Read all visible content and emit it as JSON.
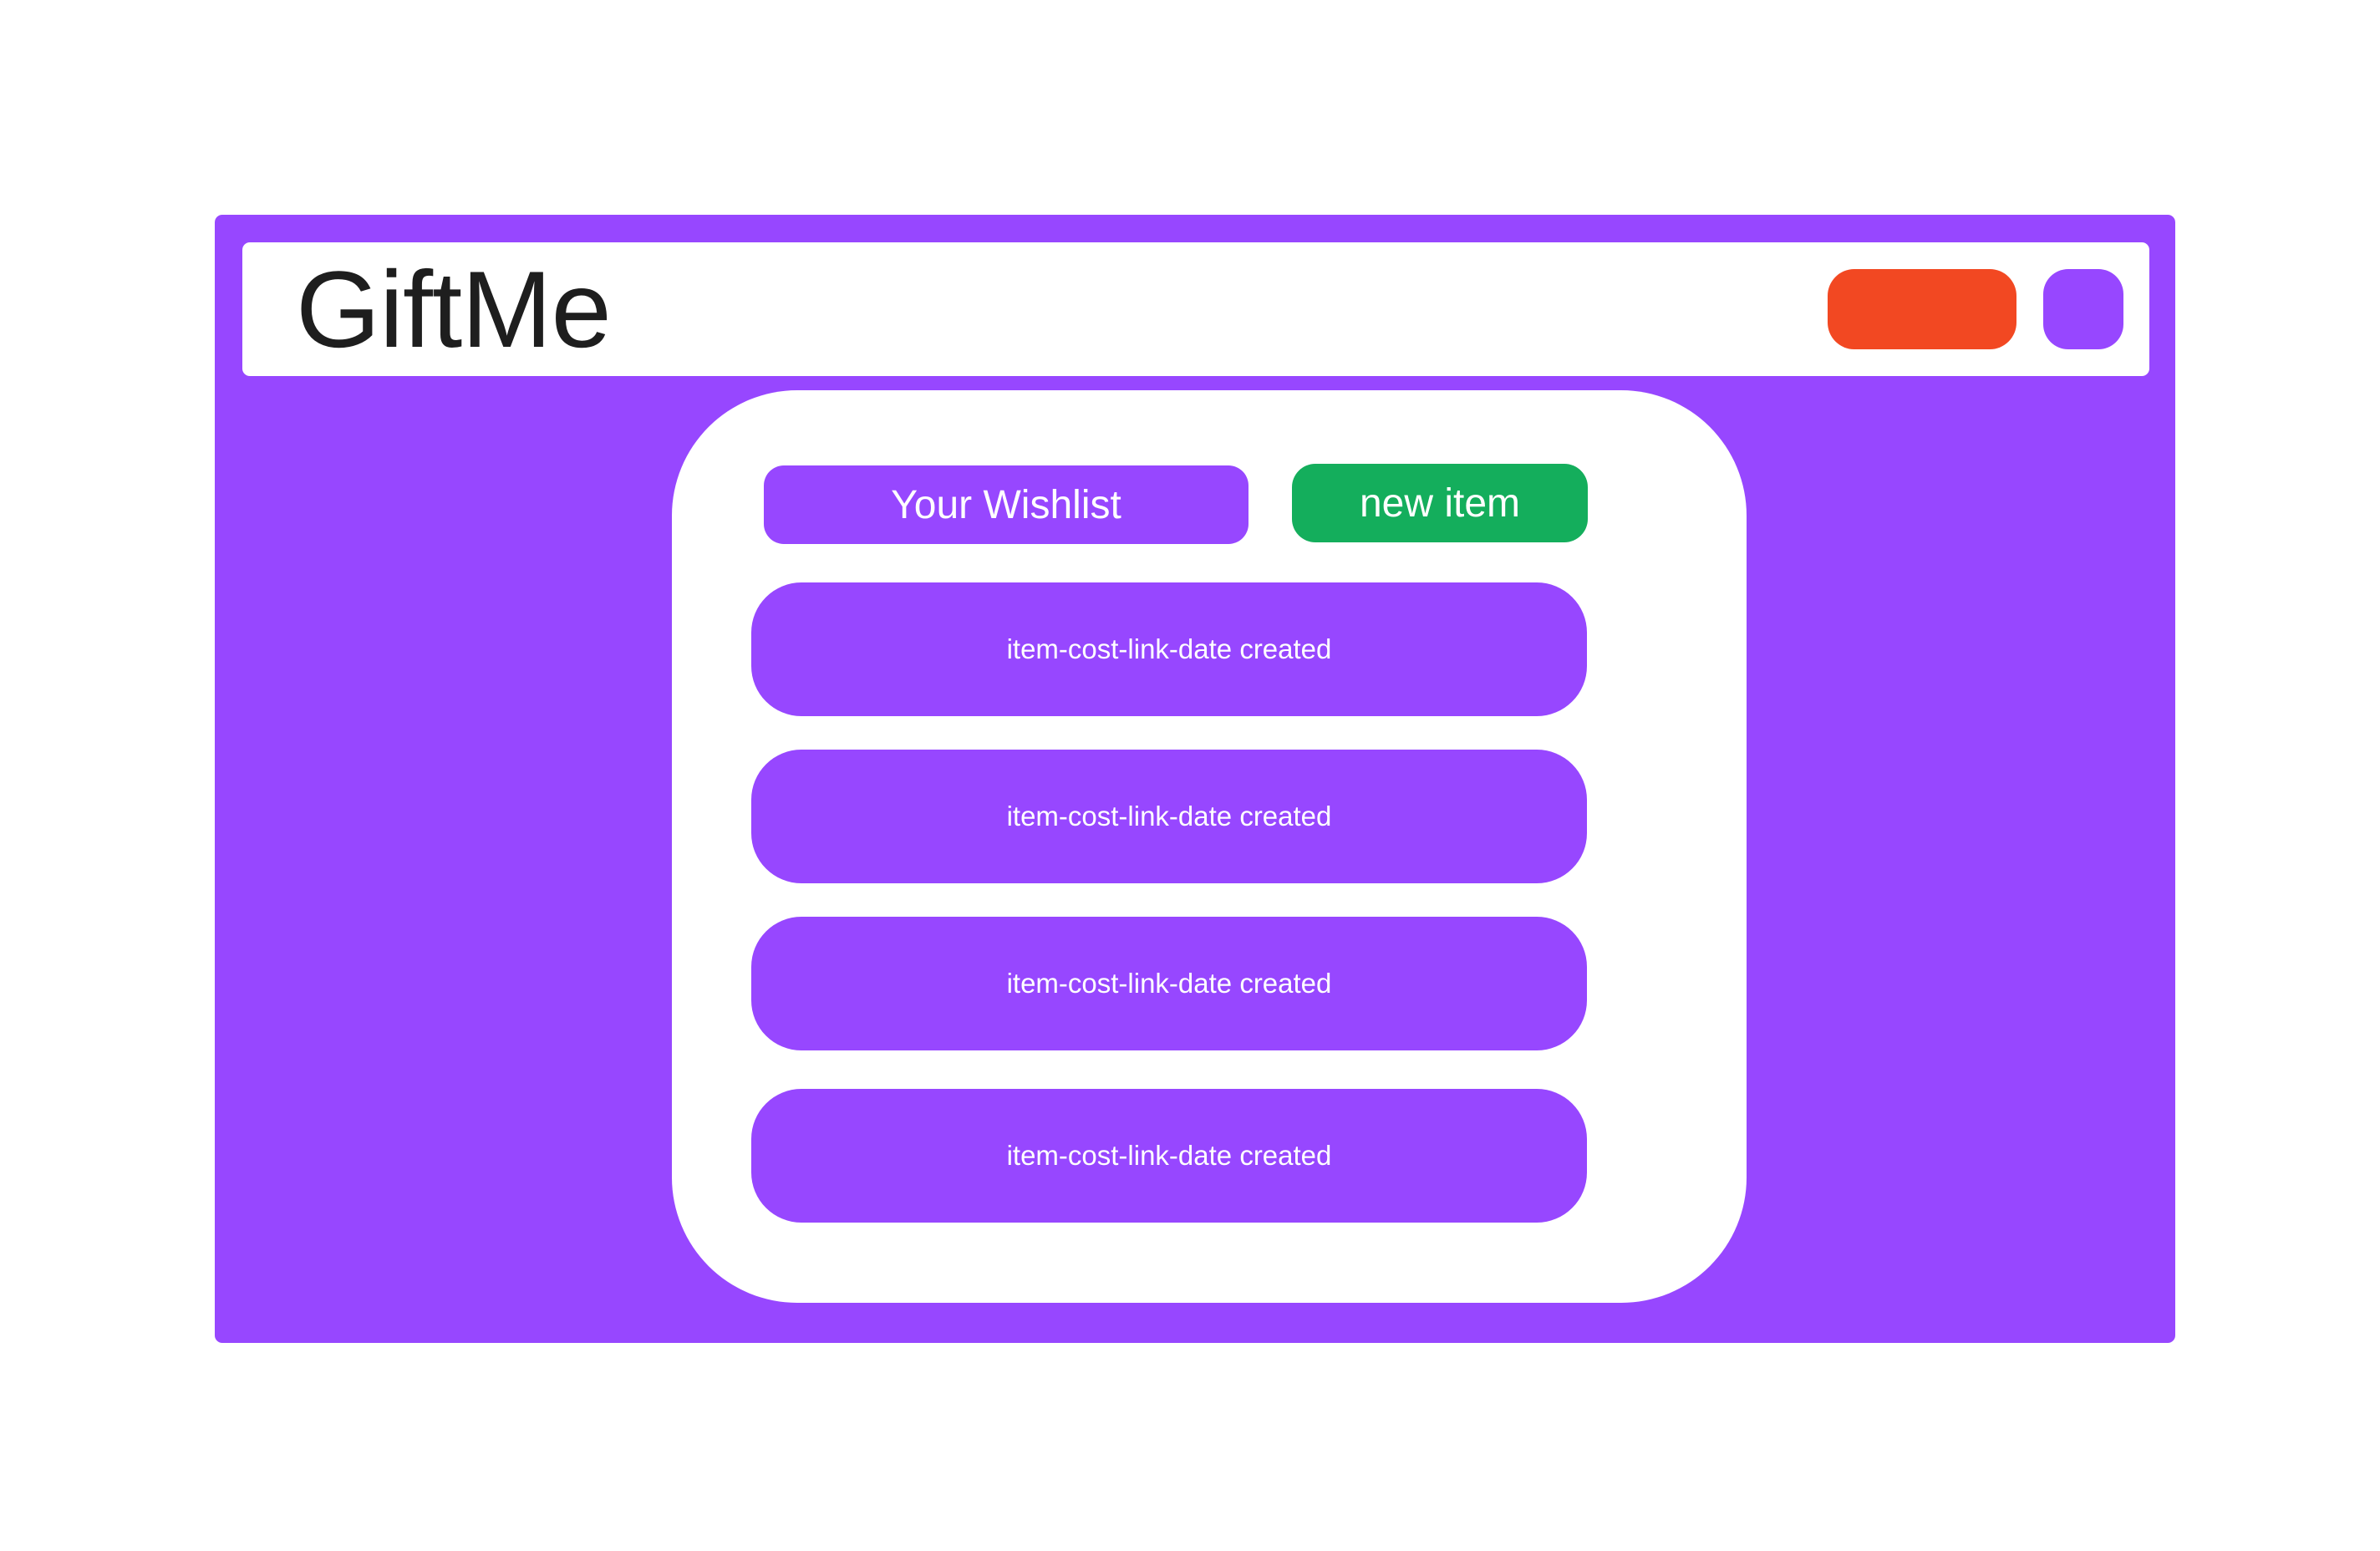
{
  "app": {
    "logo": "GiftMe"
  },
  "header": {
    "buttons": [
      {
        "icon": "red-pill-button",
        "color": "#F24822"
      },
      {
        "icon": "purple-square-button",
        "color": "#9747FF"
      }
    ]
  },
  "wishlist": {
    "title": "Your Wishlist",
    "new_item_label": "new item",
    "items": [
      {
        "label": "item-cost-link-date created"
      },
      {
        "label": "item-cost-link-date created"
      },
      {
        "label": "item-cost-link-date created"
      },
      {
        "label": "item-cost-link-date created"
      }
    ]
  },
  "colors": {
    "brand": "#9747FF",
    "accent_green": "#14AE5C",
    "accent_red": "#F24822",
    "text_dark": "#1E1E1E"
  }
}
